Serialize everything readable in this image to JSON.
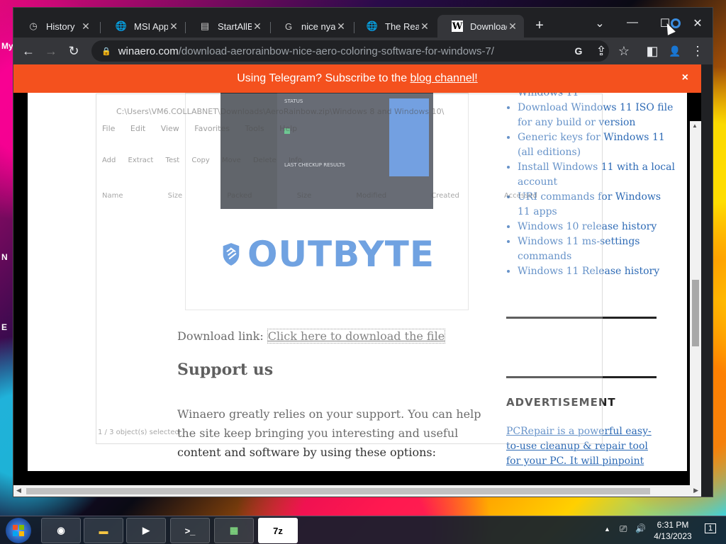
{
  "desktop": {
    "icon_labels": [
      "My",
      "N",
      "E"
    ]
  },
  "tabs": [
    {
      "title": "History",
      "icon": "history-icon",
      "icon_glyph": "◷"
    },
    {
      "title": "MSI App P",
      "icon": "globe-icon",
      "icon_glyph": "🌐"
    },
    {
      "title": "StartAllBa",
      "icon": "document-icon",
      "icon_glyph": "▤"
    },
    {
      "title": "nice nyan",
      "icon": "google-icon",
      "icon_glyph": "G"
    },
    {
      "title": "The Real S",
      "icon": "globe-icon",
      "icon_glyph": "🌐"
    },
    {
      "title": "Download",
      "icon": "winaero-icon",
      "icon_glyph": "W"
    }
  ],
  "active_tab_index": 5,
  "window_controls": {
    "dropdown": "⌄",
    "minimize": "—",
    "maximize": "☐",
    "close": "✕"
  },
  "toolbar": {
    "back": "←",
    "forward": "→",
    "reload": "↻",
    "url_host": "winaero.com",
    "url_path": "/download-aerorainbow-nice-aero-coloring-software-for-windows-7/",
    "icons": {
      "google": "G",
      "share": "⇪",
      "bookmark": "☆",
      "sidebar": "◧",
      "profile": "👤",
      "menu": "⋮"
    }
  },
  "banner": {
    "prefix": "Using Telegram? Subscribe to the ",
    "link": "blog channel!",
    "close": "×"
  },
  "ad_image": {
    "brand": "OUTBYTE",
    "status_title": "STATUS",
    "label": "LAST CHECKUP RESULTS"
  },
  "download": {
    "label": "Download link: ",
    "link": "Click here to download the file"
  },
  "support": {
    "heading": "Support us",
    "text": "Winaero greatly relies on your support. You can help the site keep bringing you interesting and useful content and software by using these options:"
  },
  "sidebar": {
    "links": [
      "Windows 11",
      "Download Windows 11 ISO file for any build or version",
      "Generic keys for Windows 11 (all editions)",
      "Install Windows 11 with a local account",
      "URI commands for Windows 11 apps",
      "Windows 10 release history",
      "Windows 11 ms-settings commands",
      "Windows 11 Release history"
    ],
    "advertisement_heading": "ADVERTISEMENT",
    "advertisement_text": "PCRepair is a powerful easy-to-use cleanup & repair tool for your PC. It will pinpoint error"
  },
  "ghost_window": {
    "title": "C:\\Users\\VM6.COLLABNET\\Downloads\\AeroRainbow.zip\\Windows 8 and Windows 10\\",
    "menu": "File Edit View Favorites Tools Help",
    "tools": "Add Extract Test Copy Move Delete Info",
    "columns": "Name Size Packed Size Modified Created Accessed",
    "status": "1 / 3 object(s) selected"
  },
  "taskbar": {
    "apps": [
      {
        "name": "chrome",
        "glyph": "◉"
      },
      {
        "name": "file-explorer",
        "glyph": "▬"
      },
      {
        "name": "media-player",
        "glyph": "▶"
      },
      {
        "name": "terminal",
        "glyph": ">_"
      },
      {
        "name": "game-app",
        "glyph": "▦"
      },
      {
        "name": "7zip",
        "glyph": "7z"
      }
    ],
    "tray": {
      "up": "▲",
      "network": "⎚",
      "volume": "🔊",
      "notification": "1"
    },
    "time": "6:31 PM",
    "date": "4/13/2023"
  }
}
